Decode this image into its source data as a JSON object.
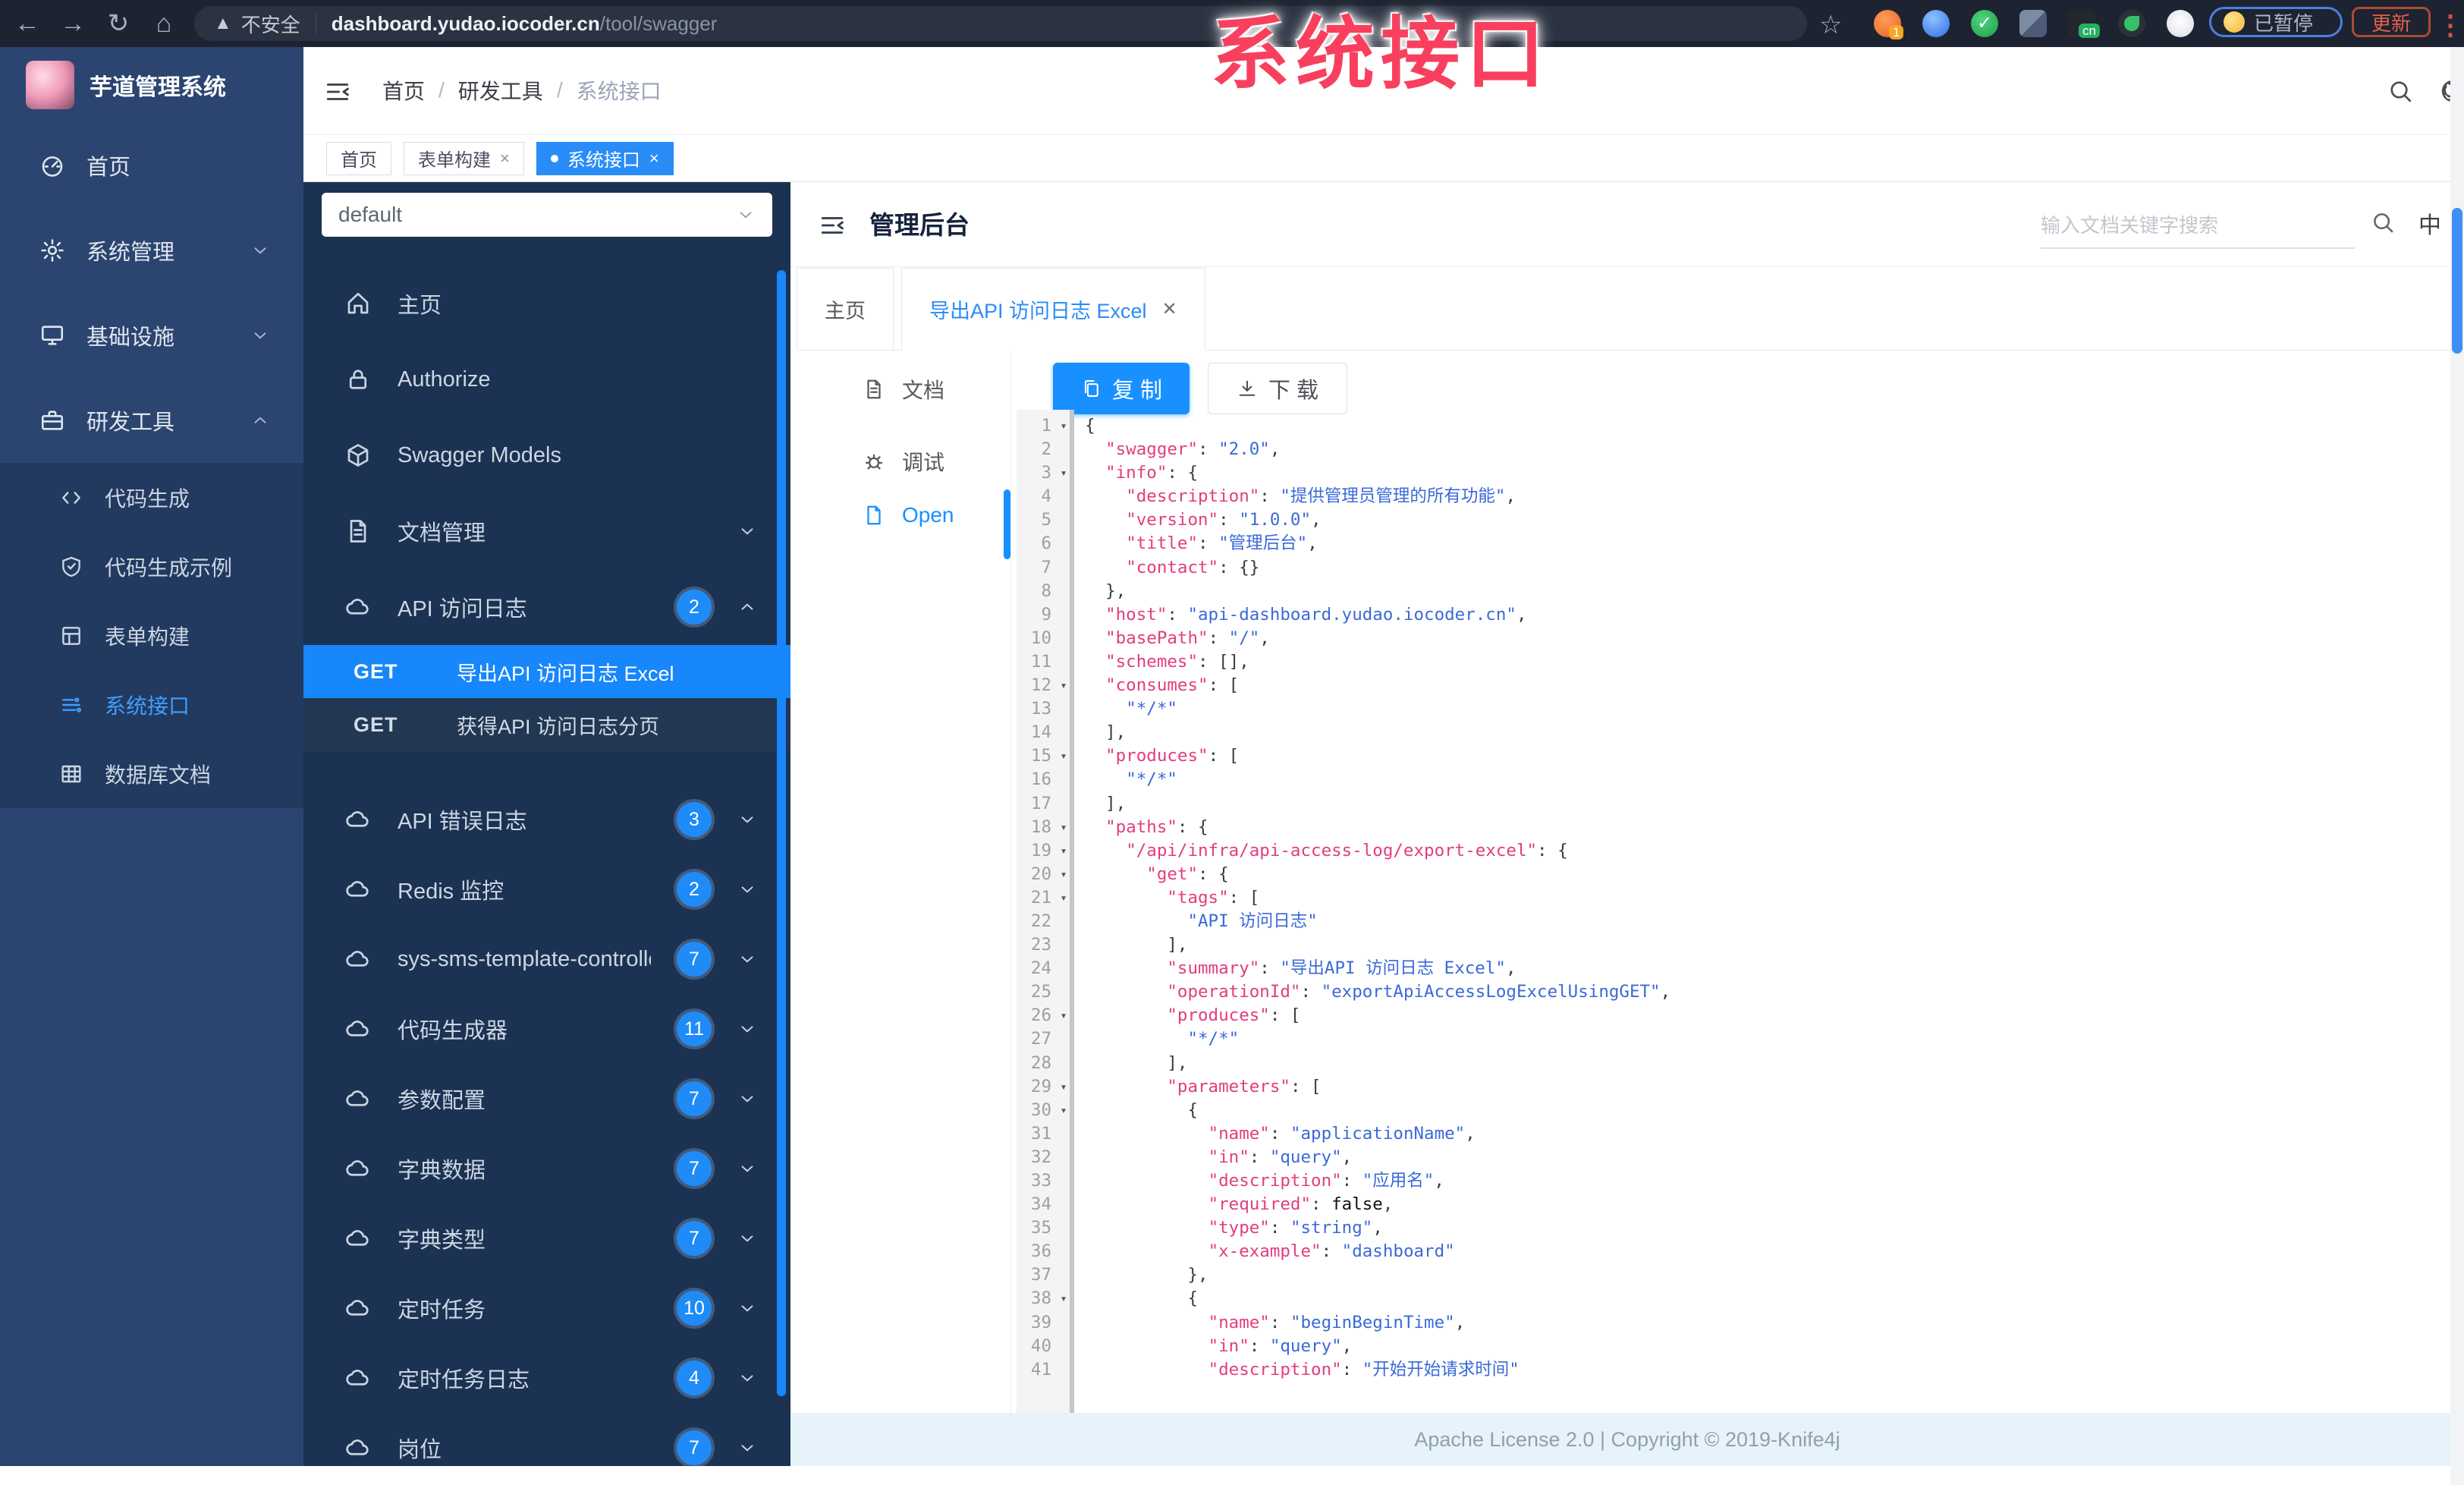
{
  "colors": {
    "accent": "#1890ff",
    "active_get_row": "#1787fb",
    "sidebar": "#2b4570",
    "swagger_panel": "#1c3252",
    "overlay_text": "#f8405e",
    "footer_bg": "#e7f3fb",
    "tag_active": "#2a8cf7"
  },
  "overlay": {
    "title": "系统接口"
  },
  "browser": {
    "security_label": "不安全",
    "url_host": "dashboard.yudao.iocoder.cn",
    "url_path": "/tool/swagger",
    "ext_badge": "1",
    "ext_cn": "cn",
    "paused_label": "已暂停",
    "update_label": "更新"
  },
  "header": {
    "breadcrumb": [
      "首页",
      "研发工具",
      "系统接口"
    ],
    "breadcrumb_sep": "/"
  },
  "sidebar": {
    "logo_title": "芋道管理系统",
    "items": [
      {
        "label": "首页",
        "icon": "dashboard"
      },
      {
        "label": "系统管理",
        "icon": "gear",
        "chevron": "down"
      },
      {
        "label": "基础设施",
        "icon": "monitor",
        "chevron": "down"
      },
      {
        "label": "研发工具",
        "icon": "briefcase",
        "chevron": "up"
      }
    ],
    "sub_items": [
      {
        "label": "代码生成",
        "icon": "code"
      },
      {
        "label": "代码生成示例",
        "icon": "shield"
      },
      {
        "label": "表单构建",
        "icon": "grid"
      },
      {
        "label": "系统接口",
        "icon": "api",
        "active": true
      },
      {
        "label": "数据库文档",
        "icon": "table"
      }
    ]
  },
  "tags": [
    {
      "label": "首页"
    },
    {
      "label": "表单构建",
      "closable": true
    },
    {
      "label": "系统接口",
      "closable": true,
      "active": true
    }
  ],
  "swagger": {
    "select_value": "default",
    "items": [
      {
        "label": "主页",
        "icon": "home"
      },
      {
        "label": "Authorize",
        "icon": "lock"
      },
      {
        "label": "Swagger Models",
        "icon": "cube"
      },
      {
        "label": "文档管理",
        "icon": "doc",
        "chevron": "down"
      },
      {
        "label": "API 访问日志",
        "icon": "cloud",
        "badge": "2",
        "chevron": "up"
      }
    ],
    "api_rows": [
      {
        "method": "GET",
        "label": "导出API 访问日志 Excel",
        "active": true
      },
      {
        "method": "GET",
        "label": "获得API 访问日志分页"
      }
    ],
    "groups": [
      {
        "label": "API 错误日志",
        "badge": "3"
      },
      {
        "label": "Redis 监控",
        "badge": "2"
      },
      {
        "label": "sys-sms-template-controller",
        "badge": "7"
      },
      {
        "label": "代码生成器",
        "badge": "11"
      },
      {
        "label": "参数配置",
        "badge": "7"
      },
      {
        "label": "字典数据",
        "badge": "7"
      },
      {
        "label": "字典类型",
        "badge": "7"
      },
      {
        "label": "定时任务",
        "badge": "10"
      },
      {
        "label": "定时任务日志",
        "badge": "4"
      },
      {
        "label": "岗位",
        "badge": "7"
      }
    ]
  },
  "doc": {
    "title": "管理后台",
    "search_placeholder": "输入文档关键字搜索",
    "lang_label": "中",
    "tabs": [
      {
        "label": "主页"
      },
      {
        "label": "导出API 访问日志 Excel",
        "closable": true,
        "active": true
      }
    ],
    "side_tabs": [
      {
        "label": "文档",
        "icon": "doc"
      },
      {
        "label": "调试",
        "icon": "bug"
      },
      {
        "label": "Open",
        "icon": "file",
        "active": true
      }
    ],
    "copy_label": "复 制",
    "download_label": "下 载"
  },
  "code": {
    "lines": [
      {
        "f": 1,
        "s": [
          [
            "p",
            "{"
          ]
        ]
      },
      {
        "s": [
          [
            "p",
            "  "
          ],
          [
            "k",
            "\"swagger\""
          ],
          [
            "p",
            ": "
          ],
          [
            "s",
            "\"2.0\""
          ],
          [
            "p",
            ","
          ]
        ]
      },
      {
        "f": 1,
        "s": [
          [
            "p",
            "  "
          ],
          [
            "k",
            "\"info\""
          ],
          [
            "p",
            ": {"
          ]
        ]
      },
      {
        "s": [
          [
            "p",
            "    "
          ],
          [
            "k",
            "\"description\""
          ],
          [
            "p",
            ": "
          ],
          [
            "s",
            "\"提供管理员管理的所有功能\""
          ],
          [
            "p",
            ","
          ]
        ]
      },
      {
        "s": [
          [
            "p",
            "    "
          ],
          [
            "k",
            "\"version\""
          ],
          [
            "p",
            ": "
          ],
          [
            "s",
            "\"1.0.0\""
          ],
          [
            "p",
            ","
          ]
        ]
      },
      {
        "s": [
          [
            "p",
            "    "
          ],
          [
            "k",
            "\"title\""
          ],
          [
            "p",
            ": "
          ],
          [
            "s",
            "\"管理后台\""
          ],
          [
            "p",
            ","
          ]
        ]
      },
      {
        "s": [
          [
            "p",
            "    "
          ],
          [
            "k",
            "\"contact\""
          ],
          [
            "p",
            ": {}"
          ]
        ]
      },
      {
        "s": [
          [
            "p",
            "  },"
          ]
        ]
      },
      {
        "s": [
          [
            "p",
            "  "
          ],
          [
            "k",
            "\"host\""
          ],
          [
            "p",
            ": "
          ],
          [
            "s",
            "\"api-dashboard.yudao.iocoder.cn\""
          ],
          [
            "p",
            ","
          ]
        ]
      },
      {
        "s": [
          [
            "p",
            "  "
          ],
          [
            "k",
            "\"basePath\""
          ],
          [
            "p",
            ": "
          ],
          [
            "s",
            "\"/\""
          ],
          [
            "p",
            ","
          ]
        ]
      },
      {
        "s": [
          [
            "p",
            "  "
          ],
          [
            "k",
            "\"schemes\""
          ],
          [
            "p",
            ": [],"
          ]
        ]
      },
      {
        "f": 1,
        "s": [
          [
            "p",
            "  "
          ],
          [
            "k",
            "\"consumes\""
          ],
          [
            "p",
            ": ["
          ]
        ]
      },
      {
        "s": [
          [
            "p",
            "    "
          ],
          [
            "s",
            "\"*/*\""
          ]
        ]
      },
      {
        "s": [
          [
            "p",
            "  ],"
          ]
        ]
      },
      {
        "f": 1,
        "s": [
          [
            "p",
            "  "
          ],
          [
            "k",
            "\"produces\""
          ],
          [
            "p",
            ": ["
          ]
        ]
      },
      {
        "s": [
          [
            "p",
            "    "
          ],
          [
            "s",
            "\"*/*\""
          ]
        ]
      },
      {
        "s": [
          [
            "p",
            "  ],"
          ]
        ]
      },
      {
        "f": 1,
        "s": [
          [
            "p",
            "  "
          ],
          [
            "k",
            "\"paths\""
          ],
          [
            "p",
            ": {"
          ]
        ]
      },
      {
        "f": 1,
        "s": [
          [
            "p",
            "    "
          ],
          [
            "k",
            "\"/api/infra/api-access-log/export-excel\""
          ],
          [
            "p",
            ": {"
          ]
        ]
      },
      {
        "f": 1,
        "s": [
          [
            "p",
            "      "
          ],
          [
            "k",
            "\"get\""
          ],
          [
            "p",
            ": {"
          ]
        ]
      },
      {
        "f": 1,
        "s": [
          [
            "p",
            "        "
          ],
          [
            "k",
            "\"tags\""
          ],
          [
            "p",
            ": ["
          ]
        ]
      },
      {
        "s": [
          [
            "p",
            "          "
          ],
          [
            "s",
            "\"API 访问日志\""
          ]
        ]
      },
      {
        "s": [
          [
            "p",
            "        ],"
          ]
        ]
      },
      {
        "s": [
          [
            "p",
            "        "
          ],
          [
            "k",
            "\"summary\""
          ],
          [
            "p",
            ": "
          ],
          [
            "s",
            "\"导出API 访问日志 Excel\""
          ],
          [
            "p",
            ","
          ]
        ]
      },
      {
        "s": [
          [
            "p",
            "        "
          ],
          [
            "k",
            "\"operationId\""
          ],
          [
            "p",
            ": "
          ],
          [
            "s",
            "\"exportApiAccessLogExcelUsingGET\""
          ],
          [
            "p",
            ","
          ]
        ]
      },
      {
        "f": 1,
        "s": [
          [
            "p",
            "        "
          ],
          [
            "k",
            "\"produces\""
          ],
          [
            "p",
            ": ["
          ]
        ]
      },
      {
        "s": [
          [
            "p",
            "          "
          ],
          [
            "s",
            "\"*/*\""
          ]
        ]
      },
      {
        "s": [
          [
            "p",
            "        ],"
          ]
        ]
      },
      {
        "f": 1,
        "s": [
          [
            "p",
            "        "
          ],
          [
            "k",
            "\"parameters\""
          ],
          [
            "p",
            ": ["
          ]
        ]
      },
      {
        "f": 1,
        "s": [
          [
            "p",
            "          {"
          ]
        ]
      },
      {
        "s": [
          [
            "p",
            "            "
          ],
          [
            "k",
            "\"name\""
          ],
          [
            "p",
            ": "
          ],
          [
            "s",
            "\"applicationName\""
          ],
          [
            "p",
            ","
          ]
        ]
      },
      {
        "s": [
          [
            "p",
            "            "
          ],
          [
            "k",
            "\"in\""
          ],
          [
            "p",
            ": "
          ],
          [
            "s",
            "\"query\""
          ],
          [
            "p",
            ","
          ]
        ]
      },
      {
        "s": [
          [
            "p",
            "            "
          ],
          [
            "k",
            "\"description\""
          ],
          [
            "p",
            ": "
          ],
          [
            "s",
            "\"应用名\""
          ],
          [
            "p",
            ","
          ]
        ]
      },
      {
        "s": [
          [
            "p",
            "            "
          ],
          [
            "k",
            "\"required\""
          ],
          [
            "p",
            ": "
          ],
          [
            "b",
            "false"
          ],
          [
            "p",
            ","
          ]
        ]
      },
      {
        "s": [
          [
            "p",
            "            "
          ],
          [
            "k",
            "\"type\""
          ],
          [
            "p",
            ": "
          ],
          [
            "s",
            "\"string\""
          ],
          [
            "p",
            ","
          ]
        ]
      },
      {
        "s": [
          [
            "p",
            "            "
          ],
          [
            "k",
            "\"x-example\""
          ],
          [
            "p",
            ": "
          ],
          [
            "s",
            "\"dashboard\""
          ]
        ]
      },
      {
        "s": [
          [
            "p",
            "          },"
          ]
        ]
      },
      {
        "f": 1,
        "s": [
          [
            "p",
            "          {"
          ]
        ]
      },
      {
        "s": [
          [
            "p",
            "            "
          ],
          [
            "k",
            "\"name\""
          ],
          [
            "p",
            ": "
          ],
          [
            "s",
            "\"beginBeginTime\""
          ],
          [
            "p",
            ","
          ]
        ]
      },
      {
        "s": [
          [
            "p",
            "            "
          ],
          [
            "k",
            "\"in\""
          ],
          [
            "p",
            ": "
          ],
          [
            "s",
            "\"query\""
          ],
          [
            "p",
            ","
          ]
        ]
      },
      {
        "s": [
          [
            "p",
            "            "
          ],
          [
            "k",
            "\"description\""
          ],
          [
            "p",
            ": "
          ],
          [
            "s",
            "\"开始开始请求时间\""
          ]
        ]
      }
    ]
  },
  "footer": {
    "text": "Apache License 2.0 | Copyright © 2019-Knife4j"
  }
}
